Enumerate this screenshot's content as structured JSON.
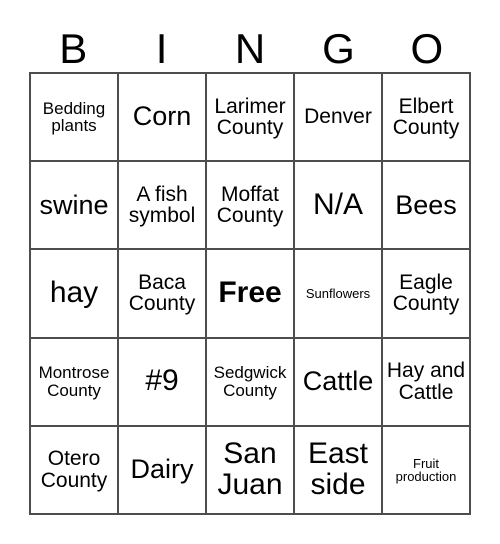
{
  "card": {
    "title": "BINGO",
    "header_letters": [
      "B",
      "I",
      "N",
      "G",
      "O"
    ],
    "free_space_label": "Free",
    "grid_rows": 5,
    "grid_cols": 5,
    "border_color": "#4d4d4d",
    "text_color": "#000000",
    "background_color": "#ffffff",
    "cells": [
      [
        {
          "text": "Bedding plants",
          "size": "sm",
          "free": false
        },
        {
          "text": "Corn",
          "size": "lg",
          "free": false
        },
        {
          "text": "Larimer County",
          "size": "md",
          "free": false
        },
        {
          "text": "Denver",
          "size": "md",
          "free": false
        },
        {
          "text": "Elbert County",
          "size": "md",
          "free": false
        }
      ],
      [
        {
          "text": "swine",
          "size": "lg",
          "free": false
        },
        {
          "text": "A fish symbol",
          "size": "md",
          "free": false
        },
        {
          "text": "Moffat County",
          "size": "md",
          "free": false
        },
        {
          "text": "N/A",
          "size": "xl",
          "free": false
        },
        {
          "text": "Bees",
          "size": "lg",
          "free": false
        }
      ],
      [
        {
          "text": "hay",
          "size": "xl",
          "free": false
        },
        {
          "text": "Baca County",
          "size": "md",
          "free": false
        },
        {
          "text": "Free",
          "size": "xl",
          "free": true
        },
        {
          "text": "Sunflowers",
          "size": "xs",
          "free": false
        },
        {
          "text": "Eagle County",
          "size": "md",
          "free": false
        }
      ],
      [
        {
          "text": "Montrose County",
          "size": "sm",
          "free": false
        },
        {
          "text": "#9",
          "size": "xl",
          "free": false
        },
        {
          "text": "Sedgwick County",
          "size": "sm",
          "free": false
        },
        {
          "text": "Cattle",
          "size": "lg",
          "free": false
        },
        {
          "text": "Hay and Cattle",
          "size": "md",
          "free": false
        }
      ],
      [
        {
          "text": "Otero County",
          "size": "md",
          "free": false
        },
        {
          "text": "Dairy",
          "size": "lg",
          "free": false
        },
        {
          "text": "San Juan",
          "size": "xl",
          "free": false
        },
        {
          "text": "East side",
          "size": "xl",
          "free": false
        },
        {
          "text": "Fruit production",
          "size": "xs",
          "free": false
        }
      ]
    ]
  }
}
